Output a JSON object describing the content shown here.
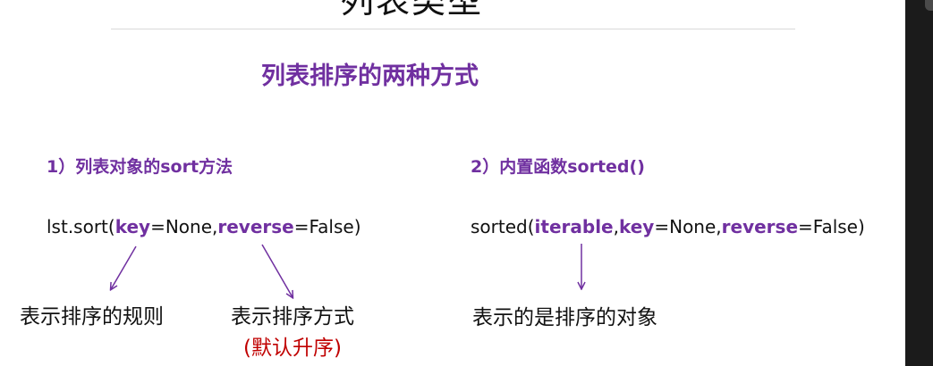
{
  "slide": {
    "title": "列表类型",
    "subtitle": "列表排序的两种方式",
    "left": {
      "heading": "1）列表对象的sort方法",
      "code": {
        "prefix": "lst.sort(",
        "kw1": "key",
        "mid": "=None,",
        "kw2": "reverse",
        "suffix": "=False)"
      },
      "note1": "表示排序的规则",
      "note2": "表示排序方式",
      "note3": "(默认升序)"
    },
    "right": {
      "heading": "2）内置函数sorted()",
      "code": {
        "prefix": "sorted(",
        "kw1": "iterable",
        "sep": ",",
        "kw2": "key",
        "mid": "=None,",
        "kw3": "reverse",
        "suffix": "=False)"
      },
      "note": "表示的是排序的对象"
    }
  },
  "colors": {
    "accent": "#7030a0",
    "emphasis": "#c00000",
    "text": "#111111",
    "rule": "#d9d9d9"
  }
}
